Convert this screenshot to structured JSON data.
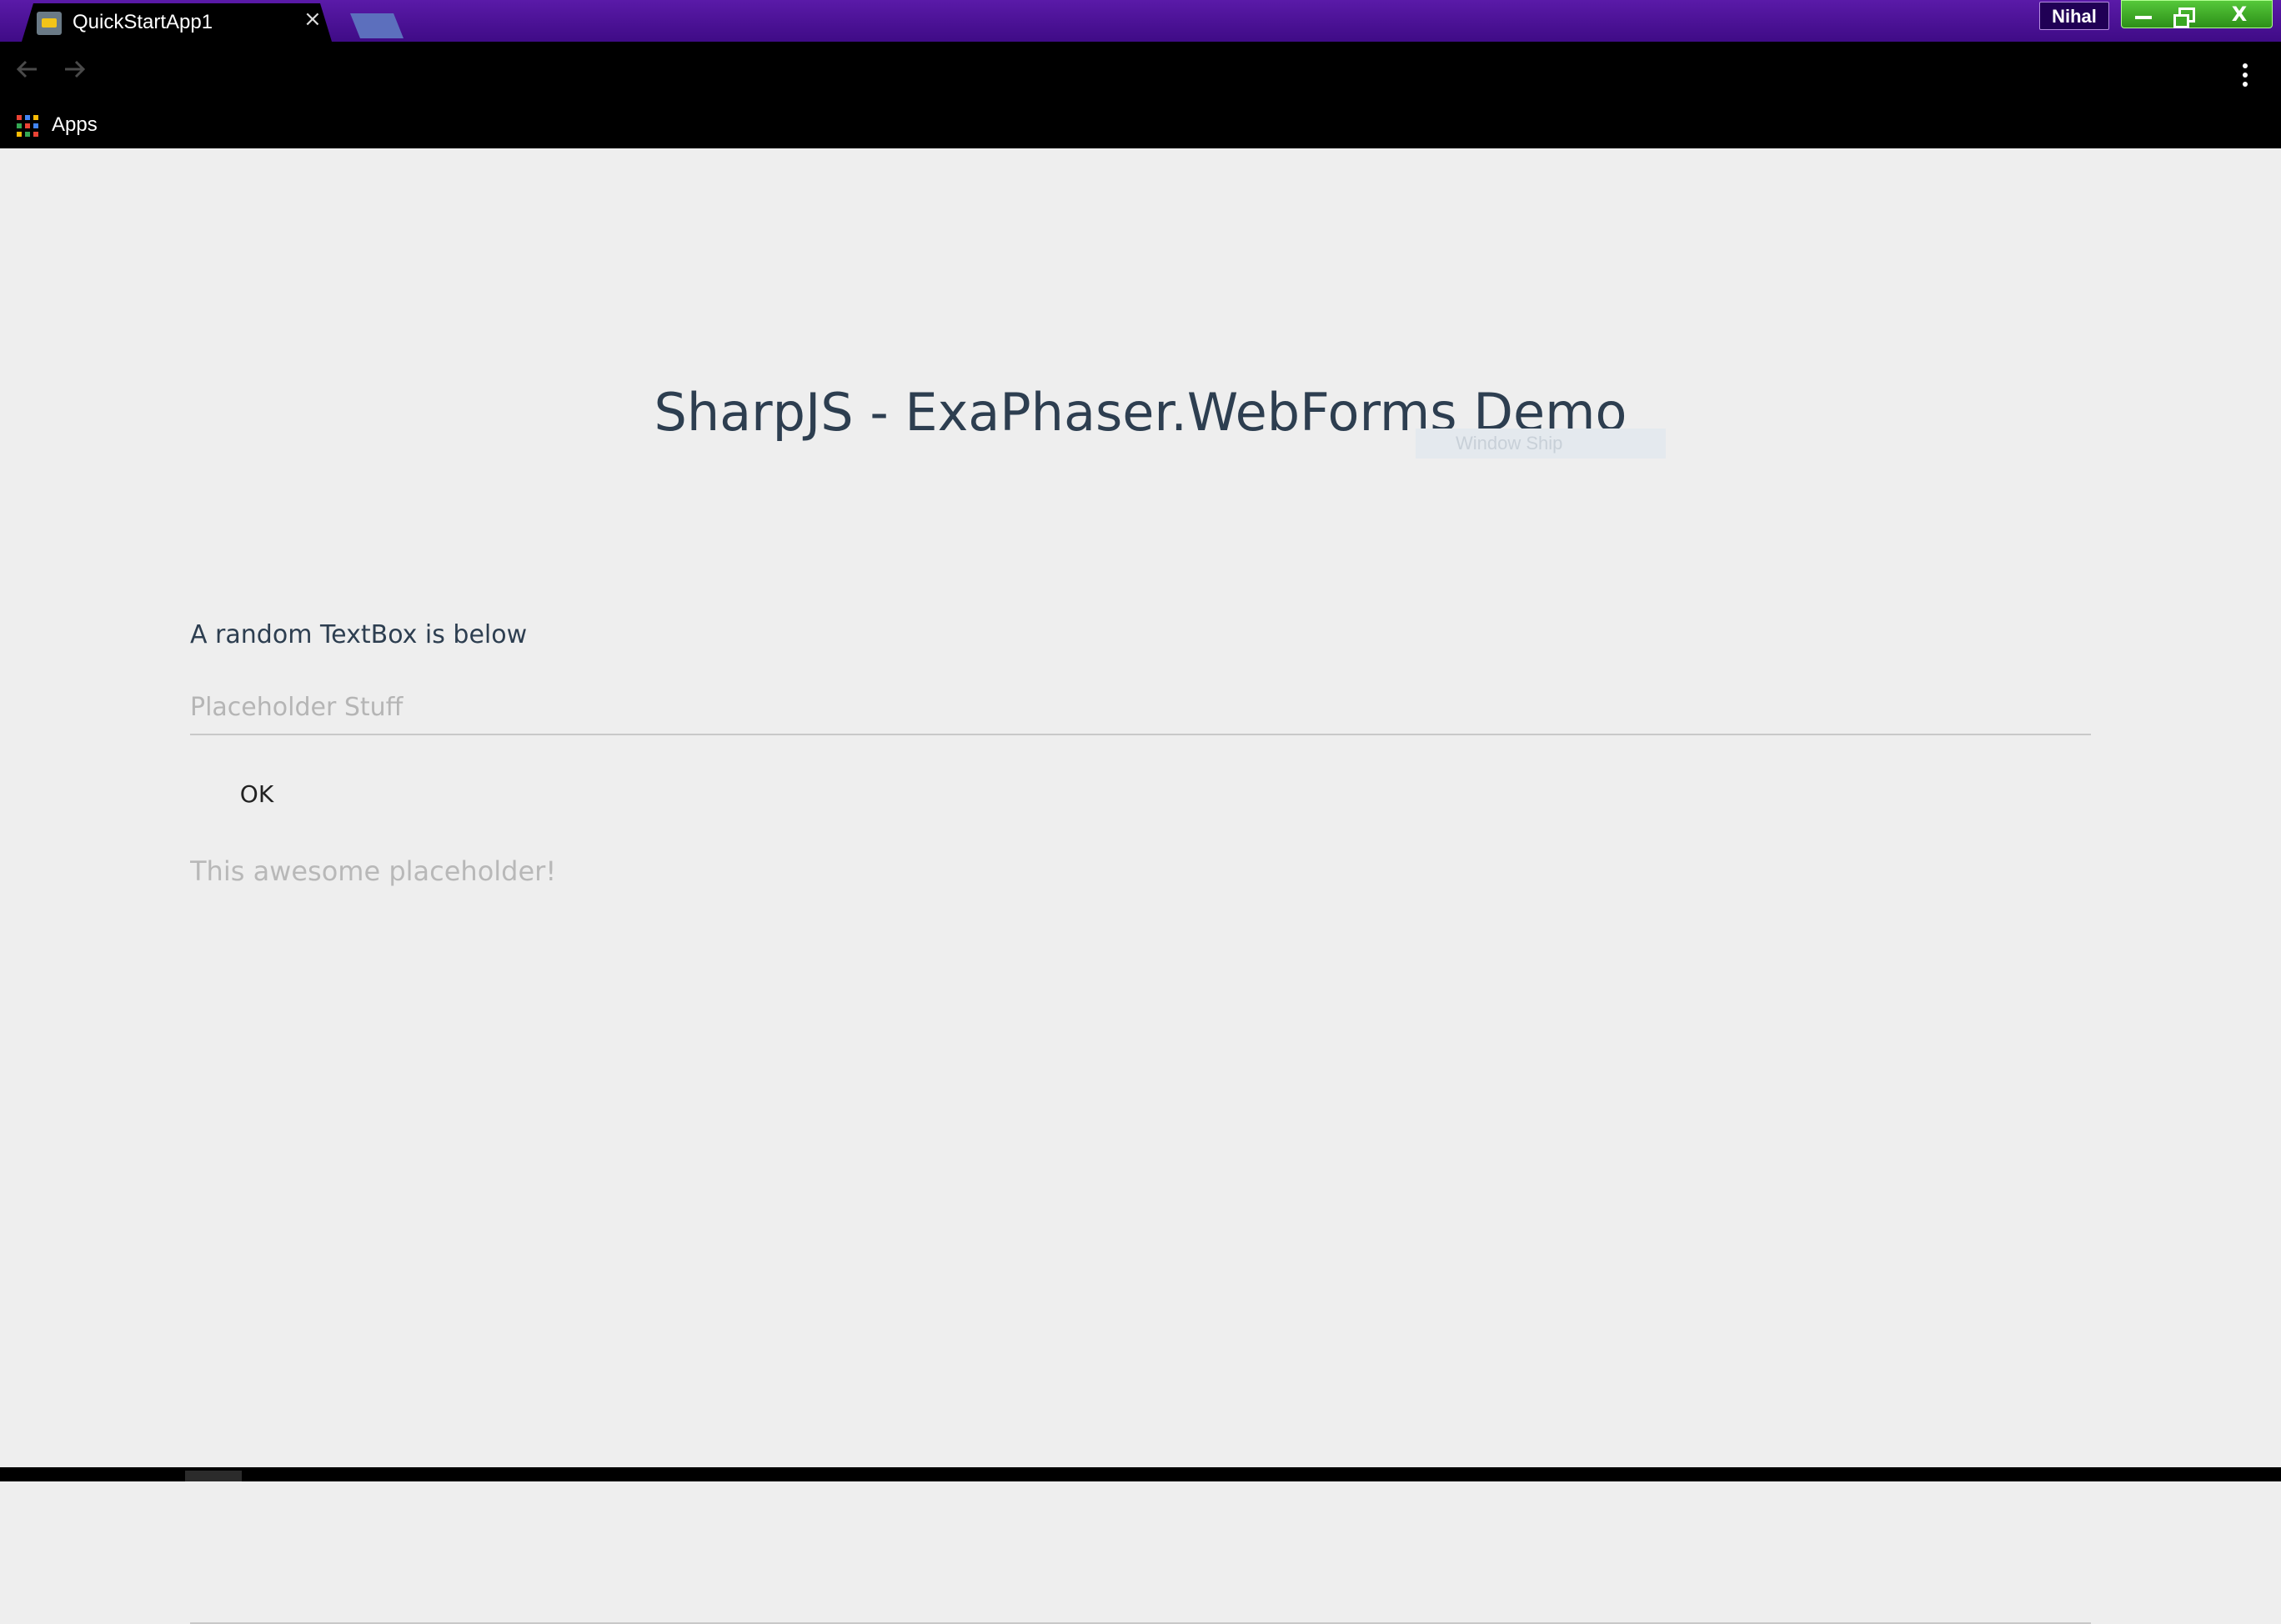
{
  "browser": {
    "tab": {
      "title": "QuickStartApp1",
      "close_glyph": "×"
    },
    "profile": {
      "name": "Nihal"
    },
    "window_controls": {
      "close_glyph": "X"
    },
    "bookmarks": {
      "apps_label": "Apps"
    },
    "icons": {
      "favicon": "app-favicon-icon",
      "back": "arrow-left-icon",
      "forward": "arrow-right-icon",
      "menu": "vertical-dots-icon",
      "apps": "apps-grid-icon"
    },
    "apps_colors": [
      "#ea4335",
      "#4285f4",
      "#fbbc05",
      "#34a853",
      "#ea4335",
      "#4285f4",
      "#fbbc05",
      "#34a853",
      "#ea4335"
    ]
  },
  "page": {
    "title": "SharpJS - ExaPhaser.WebForms Demo",
    "ghost_chip": "Window Ship",
    "intro_label": "A random TextBox is below",
    "textbox": {
      "placeholder": "Placeholder Stuff",
      "value": ""
    },
    "ok_button": "OK",
    "textarea": {
      "placeholder": "This awesome placeholder!",
      "value": ""
    }
  },
  "colors": {
    "titlebar": "#4a1095",
    "heading": "#2d3e50",
    "background": "#eeeeee",
    "window_buttons": "#3aa723"
  }
}
